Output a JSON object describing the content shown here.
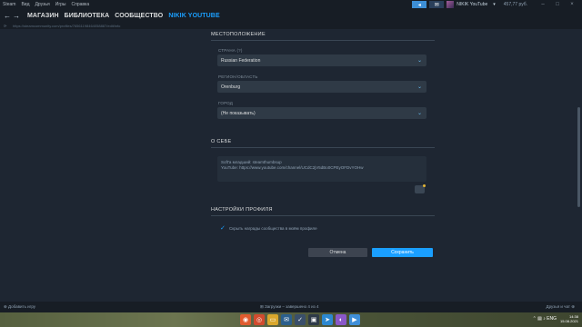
{
  "menubar": {
    "items": [
      "Steam",
      "Вид",
      "Друзья",
      "Игры",
      "Справка"
    ],
    "user_name": "NIKIK YouTube",
    "balance": "457,77 руб.",
    "colors": {
      "accent": "#1a9fff",
      "background": "#1e2632"
    }
  },
  "nav": {
    "back_icon": "arrow-left-icon",
    "forward_icon": "arrow-right-icon",
    "tabs": [
      "МАГАЗИН",
      "БИБЛИОТЕКА",
      "СООБЩЕСТВО",
      "NIKIK YOUTUBE"
    ]
  },
  "url": "https://steamcommunity.com/profiles/76561198464058887/edit/info",
  "location": {
    "section_title": "МЕСТОПОЛОЖЕНИЕ",
    "country_label": "СТРАНА (?)",
    "country_value": "Russian Federation",
    "region_label": "РЕГИОН/ОБЛАСТЬ",
    "region_value": "Orenburg",
    "city_label": "ГОРОД",
    "city_value": "(Не показывать)"
  },
  "about": {
    "section_title": "О СЕБЕ",
    "line1": "Soft'a младший: steamthumbsup",
    "line2": "YouTube: https://www.youtube.com/channel/UCdC2jV5dBo0CPEyOFDvYOHw"
  },
  "settings": {
    "section_title": "НАСТРОЙКИ ПРОФИЛЯ",
    "checkbox_label": "Скрыть награды сообщества в моём профиле",
    "checked": true
  },
  "buttons": {
    "cancel": "Отмена",
    "save": "Сохранить"
  },
  "bottom": {
    "add_game": "Добавить игру",
    "downloads": "Загрузки – завершено 4 из 4",
    "friends": "Друзья и чат"
  },
  "taskbar": {
    "time": "14:38",
    "date": "15.08.2021",
    "lang": "ENG"
  }
}
